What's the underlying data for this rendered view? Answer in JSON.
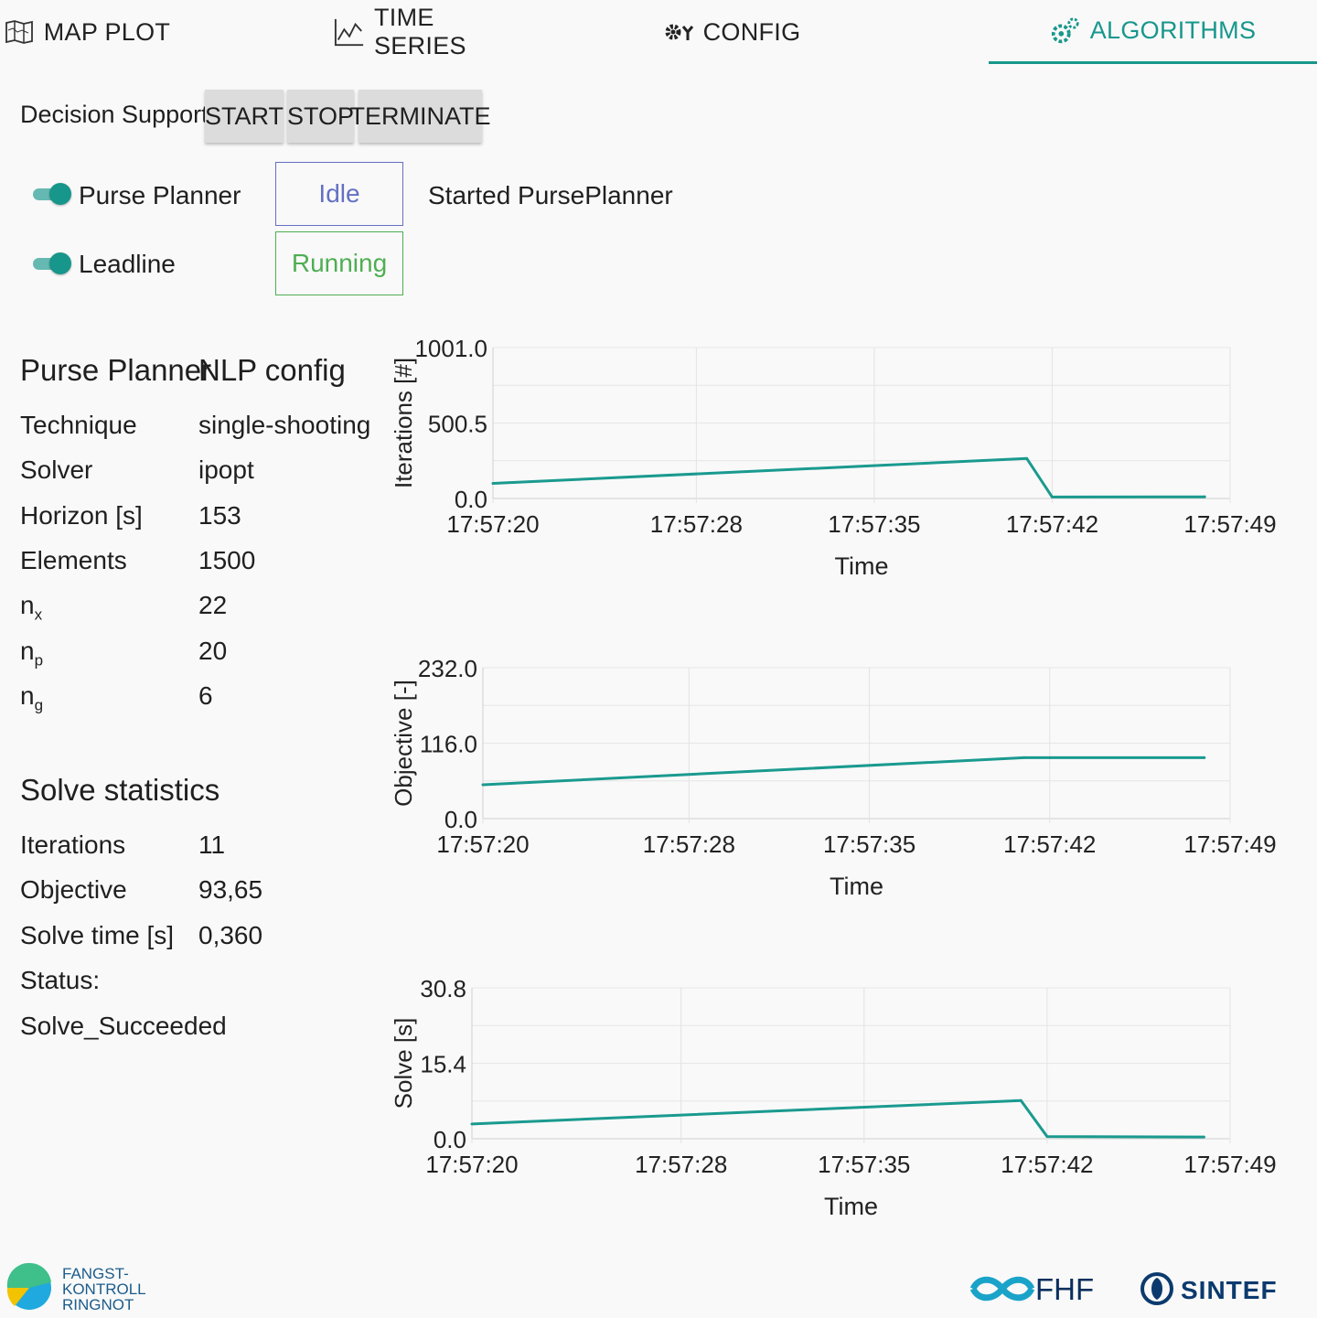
{
  "tabs": [
    {
      "label": "MAP PLOT",
      "icon": "map-icon"
    },
    {
      "label": "TIME SERIES",
      "icon": "line-chart-icon"
    },
    {
      "label": "CONFIG",
      "icon": "gears-icon"
    },
    {
      "label": "ALGORITHMS",
      "icon": "algorithm-gear-icon",
      "active": true
    }
  ],
  "decision_support": {
    "label": "Decision Support",
    "start": "START",
    "stop": "STOP",
    "terminate": "TERMINATE"
  },
  "algorithms": [
    {
      "name": "Purse Planner",
      "enabled": true,
      "status": "Idle"
    },
    {
      "name": "Leadline",
      "enabled": true,
      "status": "Running"
    }
  ],
  "log_message": "Started PursePlanner",
  "nlp": {
    "title_left": "Purse Planner",
    "title_right": "NLP config",
    "rows": [
      {
        "label": "Technique",
        "value": "single-shooting"
      },
      {
        "label": "Solver",
        "value": "ipopt"
      },
      {
        "label": "Horizon [s]",
        "value": "153"
      },
      {
        "label": "Elements",
        "value": "1500"
      },
      {
        "label": "n",
        "sub": "x",
        "value": "22"
      },
      {
        "label": "n",
        "sub": "p",
        "value": "20"
      },
      {
        "label": "n",
        "sub": "g",
        "value": "6"
      }
    ]
  },
  "solve_stats": {
    "title": "Solve statistics",
    "rows": [
      {
        "label": "Iterations",
        "value": "11"
      },
      {
        "label": "Objective",
        "value": "93,65"
      },
      {
        "label": "Solve time [s]",
        "value": "0,360"
      }
    ],
    "status_label": "Status:",
    "status_value": "Solve_Succeeded"
  },
  "chart_data": [
    {
      "type": "line",
      "ylabel": "Iterations [#]",
      "xlabel": "Time",
      "yticks": [
        "0.0",
        "500.5",
        "1001.0"
      ],
      "ylim": [
        0,
        1001
      ],
      "xticks": [
        "17:57:20",
        "17:57:28",
        "17:57:35",
        "17:57:42",
        "17:57:49"
      ],
      "xlim": [
        "17:57:20",
        "17:57:49"
      ],
      "grid": true,
      "color": "#1a9a8f",
      "x": [
        "17:57:20",
        "17:57:41",
        "17:57:42",
        "17:57:48"
      ],
      "y": [
        100,
        265,
        10,
        11
      ]
    },
    {
      "type": "line",
      "ylabel": "Objective [-]",
      "xlabel": "Time",
      "yticks": [
        "0.0",
        "116.0",
        "232.0"
      ],
      "ylim": [
        0,
        232
      ],
      "xticks": [
        "17:57:20",
        "17:57:28",
        "17:57:35",
        "17:57:42",
        "17:57:49"
      ],
      "xlim": [
        "17:57:20",
        "17:57:49"
      ],
      "grid": true,
      "color": "#1a9a8f",
      "x": [
        "17:57:20",
        "17:57:41",
        "17:57:42",
        "17:57:48"
      ],
      "y": [
        52,
        93.6,
        93.65,
        93.65
      ]
    },
    {
      "type": "line",
      "ylabel": "Solve [s]",
      "xlabel": "Time",
      "yticks": [
        "0.0",
        "15.4",
        "30.8"
      ],
      "ylim": [
        0,
        30.8
      ],
      "xticks": [
        "17:57:20",
        "17:57:28",
        "17:57:35",
        "17:57:42",
        "17:57:49"
      ],
      "xlim": [
        "17:57:20",
        "17:57:49"
      ],
      "grid": true,
      "color": "#1a9a8f",
      "x": [
        "17:57:20",
        "17:57:41",
        "17:57:42",
        "17:57:48"
      ],
      "y": [
        3.0,
        7.8,
        0.45,
        0.36
      ]
    }
  ],
  "footer": {
    "left_logo_lines": [
      "FANGST-",
      "KONTROLL",
      "RINGNOT"
    ],
    "fhf": "FHF",
    "sintef": "SINTEF"
  },
  "colors": {
    "accent": "#18978c",
    "idle": "#6470c4",
    "running": "#4fae52",
    "fhf_blue": "#1aa3c9",
    "sintef_blue": "#0b3a6e"
  }
}
